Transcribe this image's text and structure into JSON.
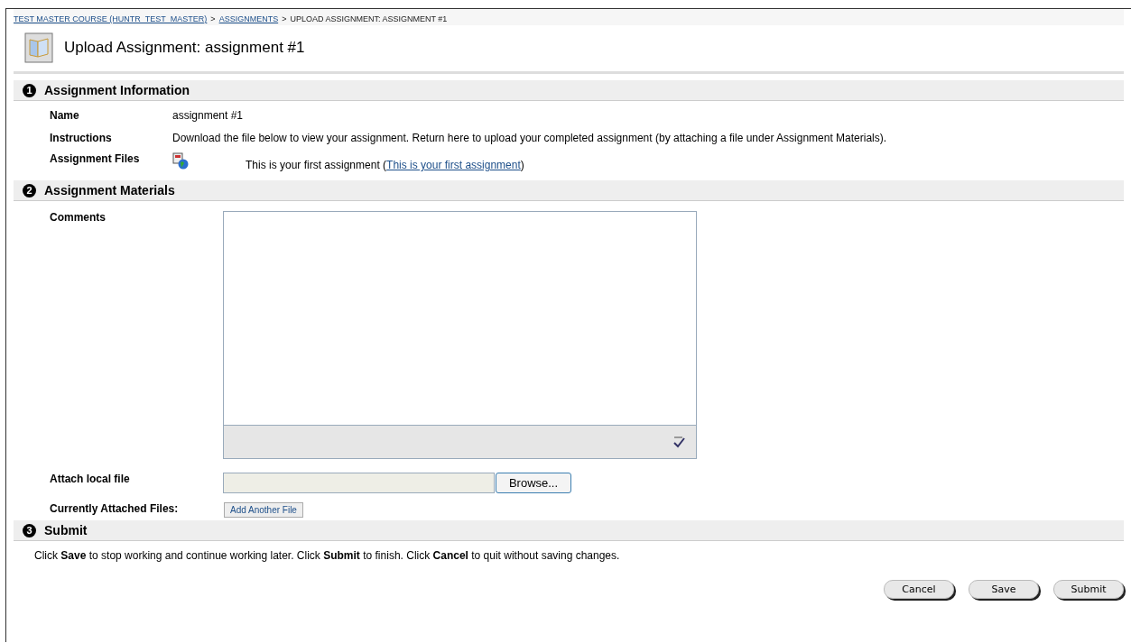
{
  "breadcrumb": [
    {
      "label": "TEST MASTER COURSE (HUNTR_TEST_MASTER)",
      "kind": "link"
    },
    {
      "label": ">",
      "kind": "separator"
    },
    {
      "label": "ASSIGNMENTS",
      "kind": "link"
    },
    {
      "label": ">",
      "kind": "separator"
    },
    {
      "label": "UPLOAD ASSIGNMENT: ASSIGNMENT #1",
      "kind": "current"
    }
  ],
  "title": "Upload Assignment: assignment #1",
  "info_section": {
    "number": "1",
    "title": "Assignment Information",
    "rows": [
      {
        "label": "Name",
        "value": "assignment #1"
      },
      {
        "label": "Instructions",
        "value": "Download the file below to view your assignment. Return here to upload your completed assignment (by attaching a file under Assignment Materials)."
      }
    ],
    "files": {
      "label": "Assignment Files",
      "text_before": "This is your first assignment (",
      "link": "This is your first assignment",
      "text_after": ")"
    }
  },
  "materials_section": {
    "number": "2",
    "title": "Assignment Materials",
    "comments_label": "Comments",
    "attach_label": "Attach local file",
    "browse_button": "Browse...",
    "attached_label": "Currently Attached Files:",
    "add_button": "Add Another File"
  },
  "submit_section": {
    "number": "3",
    "title": "Submit",
    "instructions": "Click **Save** to stop working and continue working later. Click **Submit** to finish. Click **Cancel** to quit without saving changes.",
    "buttons": [
      "Cancel",
      "Save",
      "Submit"
    ]
  }
}
